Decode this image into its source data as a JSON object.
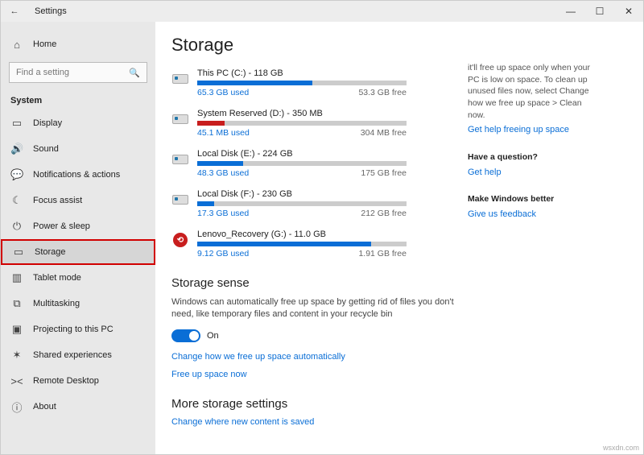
{
  "titlebar": {
    "title": "Settings"
  },
  "sidebar": {
    "home": "Home",
    "search_placeholder": "Find a setting",
    "section": "System",
    "items": [
      {
        "label": "Display",
        "icon": "▭"
      },
      {
        "label": "Sound",
        "icon": "🔊"
      },
      {
        "label": "Notifications & actions",
        "icon": "💬"
      },
      {
        "label": "Focus assist",
        "icon": "☾"
      },
      {
        "label": "Power & sleep",
        "icon": "⏻"
      },
      {
        "label": "Storage",
        "icon": "▭",
        "selected": true
      },
      {
        "label": "Tablet mode",
        "icon": "▥"
      },
      {
        "label": "Multitasking",
        "icon": "⧉"
      },
      {
        "label": "Projecting to this PC",
        "icon": "▣"
      },
      {
        "label": "Shared experiences",
        "icon": "✶"
      },
      {
        "label": "Remote Desktop",
        "icon": "><"
      },
      {
        "label": "About",
        "icon": "ⓘ"
      }
    ]
  },
  "page": {
    "title": "Storage",
    "drives": [
      {
        "name": "This PC (C:) - 118 GB",
        "used": "65.3 GB used",
        "free": "53.3 GB free",
        "pct": 55,
        "color": "blue",
        "icon": "disk"
      },
      {
        "name": "System Reserved (D:) - 350 MB",
        "used": "45.1 MB used",
        "free": "304 MB free",
        "pct": 13,
        "color": "red",
        "icon": "disk"
      },
      {
        "name": "Local Disk (E:) - 224 GB",
        "used": "48.3 GB used",
        "free": "175 GB free",
        "pct": 22,
        "color": "blue",
        "icon": "disk"
      },
      {
        "name": "Local Disk (F:) - 230 GB",
        "used": "17.3 GB used",
        "free": "212 GB free",
        "pct": 8,
        "color": "blue",
        "icon": "disk"
      },
      {
        "name": "Lenovo_Recovery (G:) - 11.0 GB",
        "used": "9.12 GB used",
        "free": "1.91 GB free",
        "pct": 83,
        "color": "blue",
        "icon": "lenovo"
      }
    ],
    "sense": {
      "heading": "Storage sense",
      "desc": "Windows can automatically free up space by getting rid of files you don't need, like temporary files and content in your recycle bin",
      "toggle_label": "On",
      "link1": "Change how we free up space automatically",
      "link2": "Free up space now"
    },
    "more": {
      "heading": "More storage settings",
      "link1": "Change where new content is saved"
    }
  },
  "aside": {
    "tip": "it'll free up space only when your PC is low on space. To clean up unused files now, select Change how we free up space > Clean now.",
    "tip_link": "Get help freeing up space",
    "q_heading": "Have a question?",
    "q_link": "Get help",
    "fb_heading": "Make Windows better",
    "fb_link": "Give us feedback"
  },
  "watermark": "wsxdn.com"
}
